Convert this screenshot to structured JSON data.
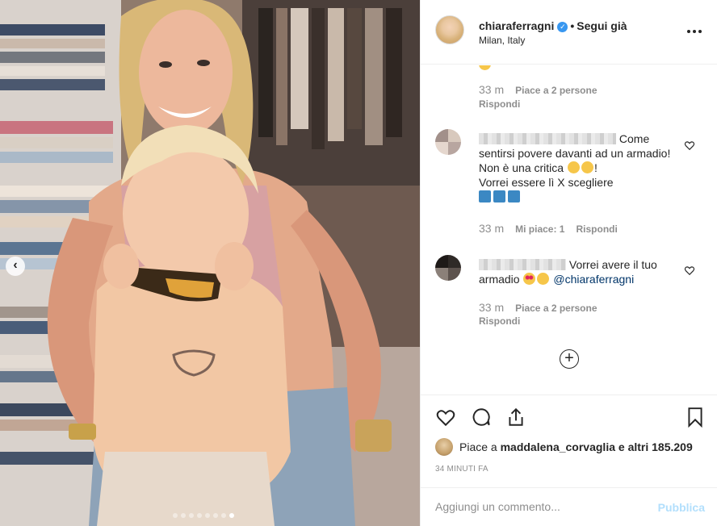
{
  "header": {
    "username": "chiaraferragni",
    "follow_label": "Segui già",
    "location": "Milan, Italy"
  },
  "comments": [
    {
      "time": "33 m",
      "likes": "Piace a 2 persone",
      "reply": "Rispondi"
    },
    {
      "text_part1": "Come sentirsi povere davanti ad un armadio! Non è una critica",
      "text_part2": "!",
      "text_part3": "Vorrei essere lì X scegliere",
      "time": "33 m",
      "likes": "Mi piace: 1",
      "reply": "Rispondi"
    },
    {
      "text_part1": "Vorrei avere il tuo armadio",
      "mention": "@chiaraferragni",
      "time": "33 m",
      "likes": "Piace a 2 persone",
      "reply": "Rispondi"
    }
  ],
  "likes_bar": {
    "prefix": "Piace a",
    "user": "maddalena_corvaglia",
    "suffix": "e altri 185.209"
  },
  "timestamp": "34 MINUTI FA",
  "add_comment": {
    "placeholder": "Aggiungi un commento...",
    "publish_label": "Pubblica"
  },
  "carousel": {
    "total": 8,
    "active_index": 7
  },
  "colors": {
    "verified": "#3897f0",
    "mention": "#003569",
    "publish_disabled": "#b2dffc",
    "meta_gray": "#8e8e8e"
  }
}
